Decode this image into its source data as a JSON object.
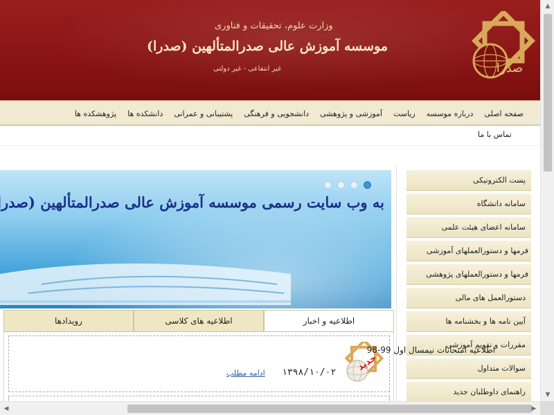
{
  "header": {
    "subtitle": "وزارت علوم، تحقیقات و فناوری",
    "title": "موسسه آموزش عالی صدرالمتألهین (صدرا)",
    "note": "غیر انتفاعی - غیر دولتی",
    "logo_text": "صدرا",
    "logo_icon": "sadra-logo-icon"
  },
  "nav": {
    "items": [
      "صفحه اصلی",
      "درباره موسسه",
      "ریاست",
      "آموزشی و پژوهشی",
      "دانشجویی و فرهنگی",
      "پشتیبانی و عمرانی",
      "دانشکده ها",
      "پژوهشکده ها"
    ],
    "contact": "تماس با ما"
  },
  "sidebar": {
    "items": [
      "پست الکترونیکی",
      "سامانه دانشگاه",
      "سامانه اعضای هیئت علمی",
      "فرمها و دستورالعملهای آموزشی",
      "فرمها و دستورالعملهای پژوهشی",
      "دستورالعمل های مالی",
      "آیین نامه ها و بخشنامه ها",
      "مقررات و تقویم آموزشی",
      "سوالات متداول",
      "راهنمای داوطلبان جدید"
    ]
  },
  "banner": {
    "text": "به وب سایت رسمی موسسه آموزش عالی صدرالمتألهین (صدرا)"
  },
  "tabs": [
    "اطلاعیه و اخبار",
    "اطلاعیه های کلاسی",
    "رویدادها"
  ],
  "news": {
    "title": "اطلاعیه امتحانات نیمسال اول 99-98",
    "date": "۱۳۹۸/۱۰/۰۲",
    "more": "ادامه مطلب",
    "badge": "جدید",
    "icon": "new-badge-icon"
  },
  "colors": {
    "header_bg": "#8a1414",
    "nav_bg": "#f0ead2",
    "banner_text": "#1a2f86",
    "link": "#2a5ca8"
  }
}
